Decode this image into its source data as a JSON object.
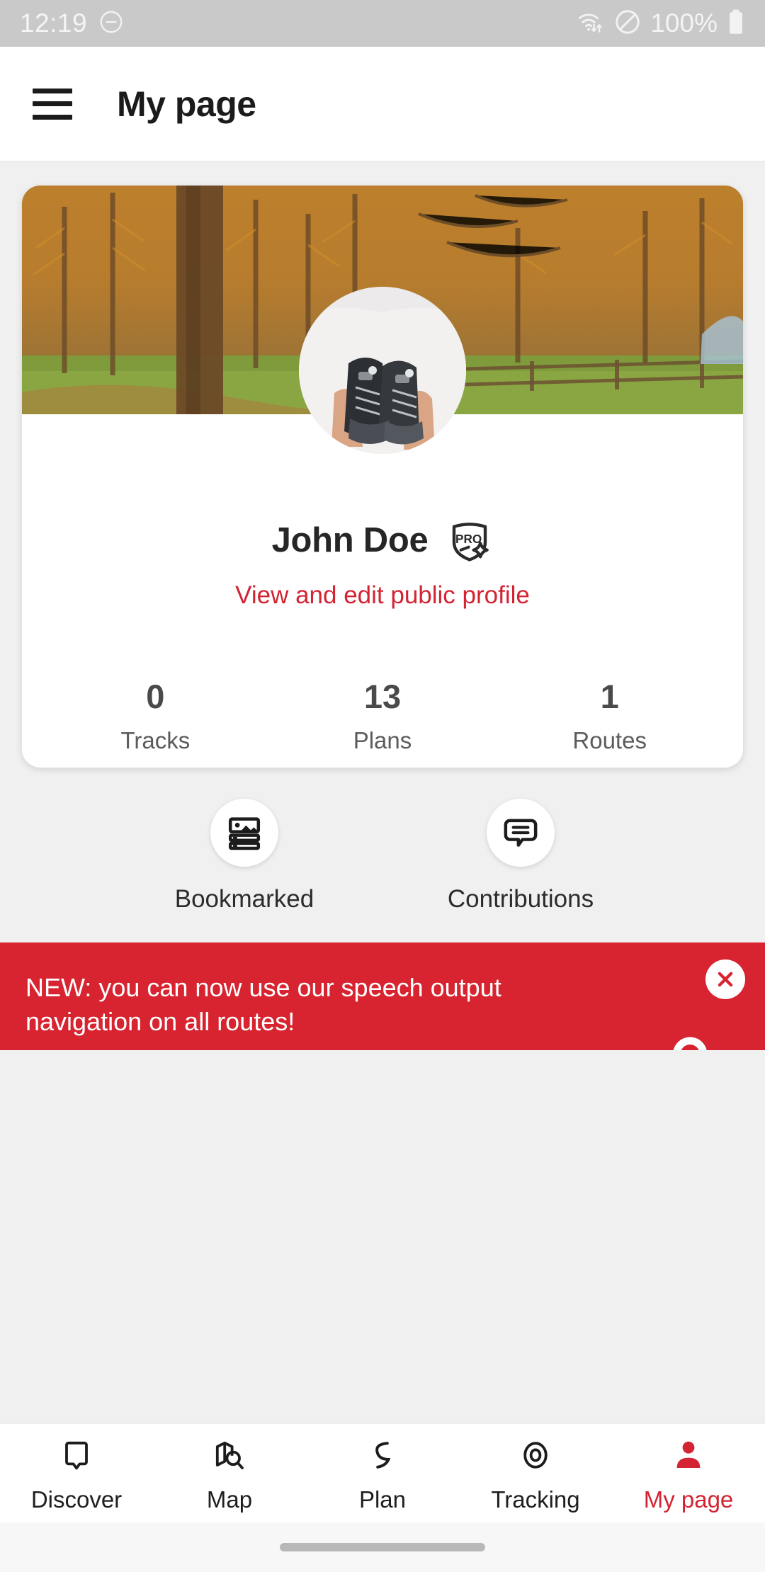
{
  "status_bar": {
    "time": "12:19",
    "dnd_icon": "circle-minus-icon",
    "wifi_icon": "wifi-data-icon",
    "no_sim_icon": "circle-slash-icon",
    "battery_percent": "100%",
    "battery_icon": "battery-full-icon"
  },
  "app_bar": {
    "menu_icon": "hamburger-menu-icon",
    "title": "My page"
  },
  "profile": {
    "cover_photo_alt": "autumn larch forest with trail",
    "avatar_alt": "hiking boots held in hands",
    "name": "John Doe",
    "pro_badge_label": "PRO",
    "profile_link": "View and edit public profile",
    "stats": [
      {
        "value": "0",
        "label": "Tracks"
      },
      {
        "value": "13",
        "label": "Plans"
      },
      {
        "value": "1",
        "label": "Routes"
      }
    ]
  },
  "quick_actions": [
    {
      "label": "Bookmarked",
      "icon": "article-list-icon"
    },
    {
      "label": "Contributions",
      "icon": "speech-bubble-lines-icon"
    }
  ],
  "banner": {
    "text": "NEW: you can now use our speech output navigation on all routes!",
    "close_icon": "close-x-icon",
    "background_color": "#d82430"
  },
  "bottom_nav": {
    "items": [
      {
        "label": "Discover",
        "icon": "speech-bubble-outline-icon",
        "active": false
      },
      {
        "label": "Map",
        "icon": "map-search-icon",
        "active": false
      },
      {
        "label": "Plan",
        "icon": "route-curve-icon",
        "active": false
      },
      {
        "label": "Tracking",
        "icon": "target-circles-icon",
        "active": false
      },
      {
        "label": "My page",
        "icon": "person-icon",
        "active": true
      }
    ],
    "active_color": "#d32434"
  }
}
